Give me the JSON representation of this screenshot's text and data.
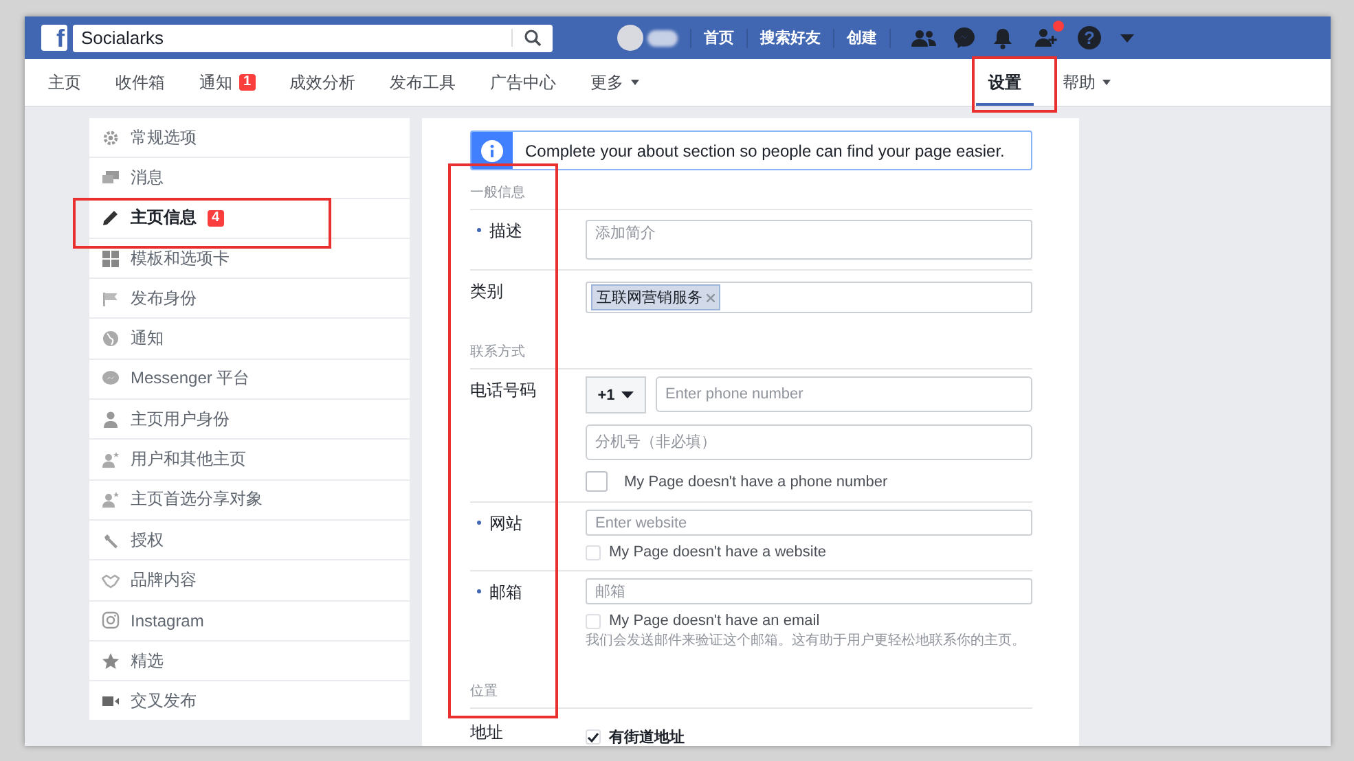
{
  "topbar": {
    "logo_letter": "f",
    "search_value": "Socialarks",
    "links": [
      "首页",
      "搜索好友",
      "创建"
    ],
    "friend_request_alert": true,
    "help_glyph": "?"
  },
  "page_tabs": [
    {
      "label": "主页",
      "selected": false,
      "kind": "link"
    },
    {
      "label": "收件箱",
      "selected": false,
      "kind": "link"
    },
    {
      "label": "通知",
      "selected": false,
      "kind": "link",
      "badge": "1"
    },
    {
      "label": "成效分析",
      "selected": false,
      "kind": "link"
    },
    {
      "label": "发布工具",
      "selected": false,
      "kind": "link"
    },
    {
      "label": "广告中心",
      "selected": false,
      "kind": "link"
    },
    {
      "label": "更多",
      "selected": false,
      "kind": "menu"
    }
  ],
  "right_tabs": [
    {
      "label": "设置",
      "selected": true,
      "kind": "link"
    },
    {
      "label": "帮助",
      "selected": false,
      "kind": "menu"
    }
  ],
  "sidebar": {
    "items": [
      {
        "label": "常规选项",
        "selected": false
      },
      {
        "label": "消息",
        "selected": false
      },
      {
        "label": "主页信息",
        "selected": true,
        "badge": "4"
      },
      {
        "label": "模板和选项卡",
        "selected": false
      },
      {
        "label": "发布身份",
        "selected": false
      },
      {
        "label": "通知",
        "selected": false
      },
      {
        "label": "Messenger 平台",
        "selected": false
      },
      {
        "label": "主页用户身份",
        "selected": false
      },
      {
        "label": "用户和其他主页",
        "selected": false
      },
      {
        "label": "主页首选分享对象",
        "selected": false
      },
      {
        "label": "授权",
        "selected": false
      },
      {
        "label": "品牌内容",
        "selected": false
      },
      {
        "label": "Instagram",
        "selected": false
      },
      {
        "label": "精选",
        "selected": false
      },
      {
        "label": "交叉发布",
        "selected": false
      }
    ]
  },
  "notice": "Complete your about section so people can find your page easier.",
  "form": {
    "general_heading": "一般信息",
    "description": {
      "label": "描述",
      "required": true,
      "placeholder": "添加简介"
    },
    "category": {
      "label": "类别",
      "tags": [
        "互联网营销服务"
      ]
    },
    "contact_heading": "联系方式",
    "phone": {
      "label": "电话号码",
      "required": false,
      "country_code": "+1",
      "placeholder": "Enter phone number",
      "extension_placeholder": "分机号（非必填）",
      "none": {
        "label": "My Page doesn't have a phone number",
        "checked": false
      }
    },
    "website": {
      "label": "网站",
      "required": true,
      "placeholder": "Enter website",
      "none": {
        "label": "My Page doesn't have a website",
        "checked": false
      }
    },
    "email": {
      "label": "邮箱",
      "required": true,
      "placeholder": "邮箱",
      "none": {
        "label": "My Page doesn't have an email",
        "checked": false
      },
      "note": "我们会发送邮件来验证这个邮箱。这有助于用户更轻松地联系你的主页。"
    },
    "location_heading": "位置",
    "address": {
      "label": "地址",
      "street": {
        "label": "有街道地址",
        "checked": true
      }
    }
  }
}
